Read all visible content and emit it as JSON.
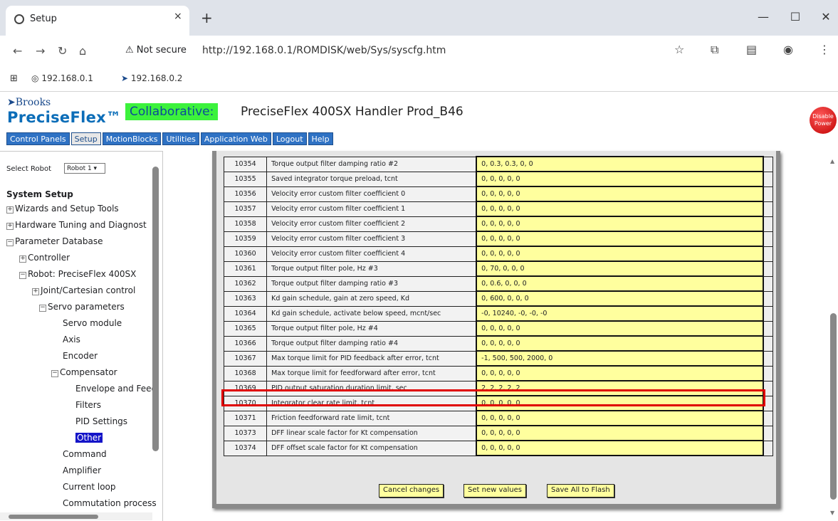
{
  "browser": {
    "tab_title": "Setup",
    "tab_close": "×",
    "new_tab": "+",
    "win_min": "—",
    "win_max": "☐",
    "win_close": "✕",
    "not_secure": "⚠ Not secure",
    "url": "http://192.168.0.1/ROMDISK/web/Sys/syscfg.htm",
    "bookmarks": [
      "192.168.0.1",
      "192.168.0.2"
    ]
  },
  "header": {
    "brand_top": "Brooks",
    "brand_main": "PreciseFlex™",
    "mode": "Collaborative:",
    "robot_title": "PreciseFlex 400SX Handler Prod_B46",
    "disable_power": "Disable Power"
  },
  "menu": [
    "Control Panels",
    "Setup",
    "MotionBlocks",
    "Utilities",
    "Application Web",
    "Logout",
    "Help"
  ],
  "sidebar": {
    "select_robot_label": "Select Robot",
    "select_robot_value": "Robot 1 ▾",
    "section_title": "System Setup",
    "items": [
      "Wizards and Setup Tools",
      "Hardware Tuning and Diagnost",
      "Parameter Database",
      "Controller",
      "Robot: PreciseFlex 400SX",
      "Joint/Cartesian control",
      "Servo parameters",
      "Servo module",
      "Axis",
      "Encoder",
      "Compensator",
      "Envelope and Feed",
      "Filters",
      "PID Settings",
      "Other",
      "Command",
      "Amplifier",
      "Current loop",
      "Commutation process"
    ]
  },
  "params": [
    {
      "id": "10354",
      "desc": "Torque output filter damping ratio #2",
      "value": "0, 0.3, 0.3, 0, 0"
    },
    {
      "id": "10355",
      "desc": "Saved integrator torque preload, tcnt",
      "value": "0, 0, 0, 0, 0"
    },
    {
      "id": "10356",
      "desc": "Velocity error custom filter coefficient 0",
      "value": "0, 0, 0, 0, 0"
    },
    {
      "id": "10357",
      "desc": "Velocity error custom filter coefficient 1",
      "value": "0, 0, 0, 0, 0"
    },
    {
      "id": "10358",
      "desc": "Velocity error custom filter coefficient 2",
      "value": "0, 0, 0, 0, 0"
    },
    {
      "id": "10359",
      "desc": "Velocity error custom filter coefficient 3",
      "value": "0, 0, 0, 0, 0"
    },
    {
      "id": "10360",
      "desc": "Velocity error custom filter coefficient 4",
      "value": "0, 0, 0, 0, 0"
    },
    {
      "id": "10361",
      "desc": "Torque output filter pole, Hz #3",
      "value": "0, 70, 0, 0, 0"
    },
    {
      "id": "10362",
      "desc": "Torque output filter damping ratio #3",
      "value": "0, 0.6, 0, 0, 0"
    },
    {
      "id": "10363",
      "desc": "Kd gain schedule, gain at zero speed, Kd",
      "value": "0, 600, 0, 0, 0"
    },
    {
      "id": "10364",
      "desc": "Kd gain schedule, activate below speed, mcnt/sec",
      "value": "-0, 10240, -0, -0, -0"
    },
    {
      "id": "10365",
      "desc": "Torque output filter pole, Hz #4",
      "value": "0, 0, 0, 0, 0"
    },
    {
      "id": "10366",
      "desc": "Torque output filter damping ratio #4",
      "value": "0, 0, 0, 0, 0"
    },
    {
      "id": "10367",
      "desc": "Max torque limit for PID feedback after error, tcnt",
      "value": "-1, 500, 500, 2000, 0"
    },
    {
      "id": "10368",
      "desc": "Max torque limit for feedforward after error, tcnt",
      "value": "0, 0, 0, 0, 0"
    },
    {
      "id": "10369",
      "desc": "PID output saturation duration limit, sec",
      "value": "2, 2, 2, 2, 2"
    },
    {
      "id": "10370",
      "desc": "Integrator clear rate limit, tcnt",
      "value": "0, 0, 0, 0, 0"
    },
    {
      "id": "10371",
      "desc": "Friction feedforward rate limit, tcnt",
      "value": "0, 0, 0, 0, 0"
    },
    {
      "id": "10373",
      "desc": " DFF linear scale factor for Kt compensation",
      "value": "0, 0, 0, 0, 0"
    },
    {
      "id": "10374",
      "desc": "DFF offset scale factor for Kt compensation",
      "value": "0, 0, 0, 0, 0"
    }
  ],
  "buttons": {
    "cancel": "Cancel changes",
    "set": "Set new values",
    "save": "Save All to Flash"
  }
}
